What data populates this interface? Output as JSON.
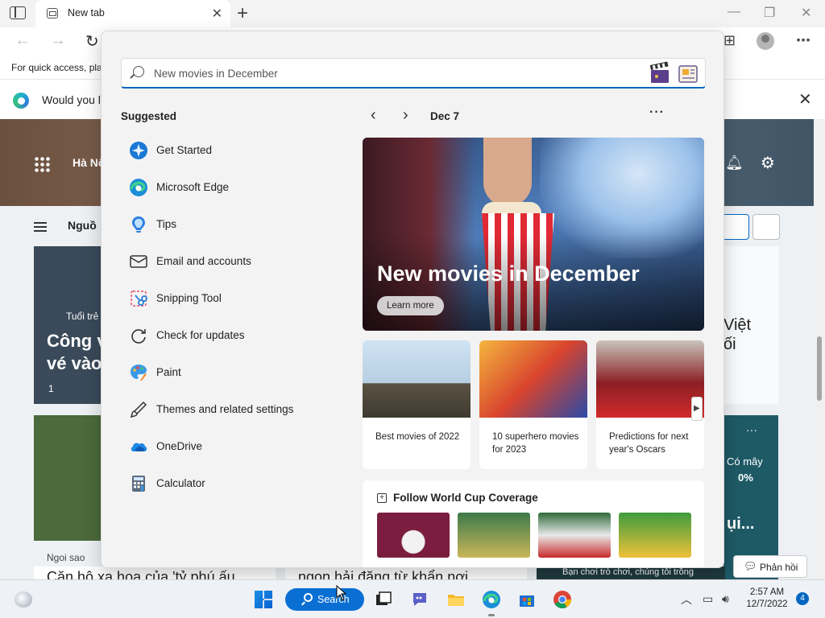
{
  "browser": {
    "tab_title": "New tab",
    "favbar_text": "For quick access, pla",
    "infobar_text": "Would you li"
  },
  "page": {
    "location": "Hà Nộ",
    "feed_source": "Nguồ",
    "card_left": {
      "source": "Tuổi trẻ",
      "title_line1": "Công v",
      "title_line2": "vé vào",
      "likes": "1"
    },
    "left_source2": "Ngoi sao",
    "right_col": {
      "line1": "Việt",
      "line2": "ối"
    },
    "weather": {
      "dots": "···",
      "condition": "Có mây",
      "precip": "0%",
      "snippet": "ụi..."
    },
    "bottom_left": "Căn hộ xa hoa của 'tỷ phú ấu",
    "bottom_mid": "ngọn hải đăng từ khẩn nơi",
    "bottom_right": "Bạn chơi trò chơi, chúng tôi trồng",
    "feedback_label": "Phản hồi"
  },
  "flyout": {
    "search": {
      "placeholder": "New movies in December"
    },
    "suggested_heading": "Suggested",
    "apps": [
      {
        "label": "Get Started",
        "icon": "get-started-icon"
      },
      {
        "label": "Microsoft Edge",
        "icon": "edge-icon"
      },
      {
        "label": "Tips",
        "icon": "tips-icon"
      },
      {
        "label": "Email and accounts",
        "icon": "mail-icon"
      },
      {
        "label": "Snipping Tool",
        "icon": "scissors-icon"
      },
      {
        "label": "Check for updates",
        "icon": "refresh-icon"
      },
      {
        "label": "Paint",
        "icon": "paint-icon"
      },
      {
        "label": "Themes and related settings",
        "icon": "brush-icon"
      },
      {
        "label": "OneDrive",
        "icon": "onedrive-icon"
      },
      {
        "label": "Calculator",
        "icon": "calculator-icon"
      }
    ],
    "date_label": "Dec 7",
    "hero": {
      "title": "New movies in December",
      "button": "Learn more"
    },
    "cards": [
      {
        "caption": "Best movies of 2022"
      },
      {
        "caption": "10 superhero movies for 2023"
      },
      {
        "caption": "Predictions for next year's Oscars"
      }
    ],
    "world_cup_title": "Follow World Cup Coverage"
  },
  "taskbar": {
    "search_label": "Search",
    "time": "2:57 AM",
    "date": "12/7/2022",
    "notifications": "4"
  },
  "colors": {
    "accent": "#0067c0",
    "taskbar_search": "#0a6fd3",
    "flyout_bg": "#f3f3f3"
  }
}
